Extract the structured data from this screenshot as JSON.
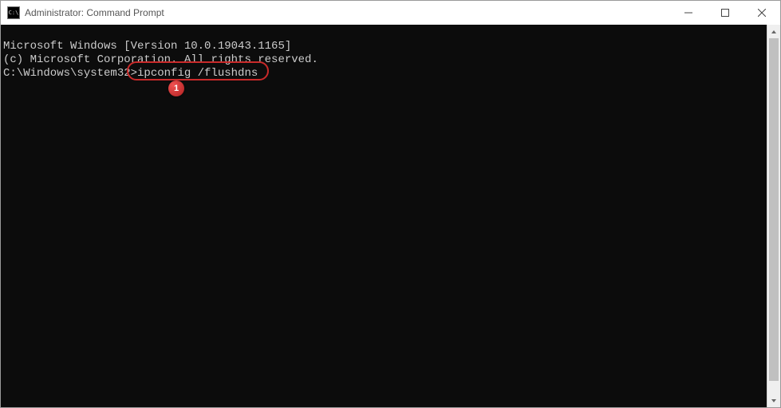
{
  "window": {
    "title": "Administrator: Command Prompt",
    "icon_label": "C:\\"
  },
  "terminal": {
    "line1": "Microsoft Windows [Version 10.0.19043.1165]",
    "line2": "(c) Microsoft Corporation. All rights reserved.",
    "blank": "",
    "prompt": "C:\\Windows\\system32>",
    "command": "ipconfig /flushdns"
  },
  "annotation": {
    "badge": "1"
  }
}
